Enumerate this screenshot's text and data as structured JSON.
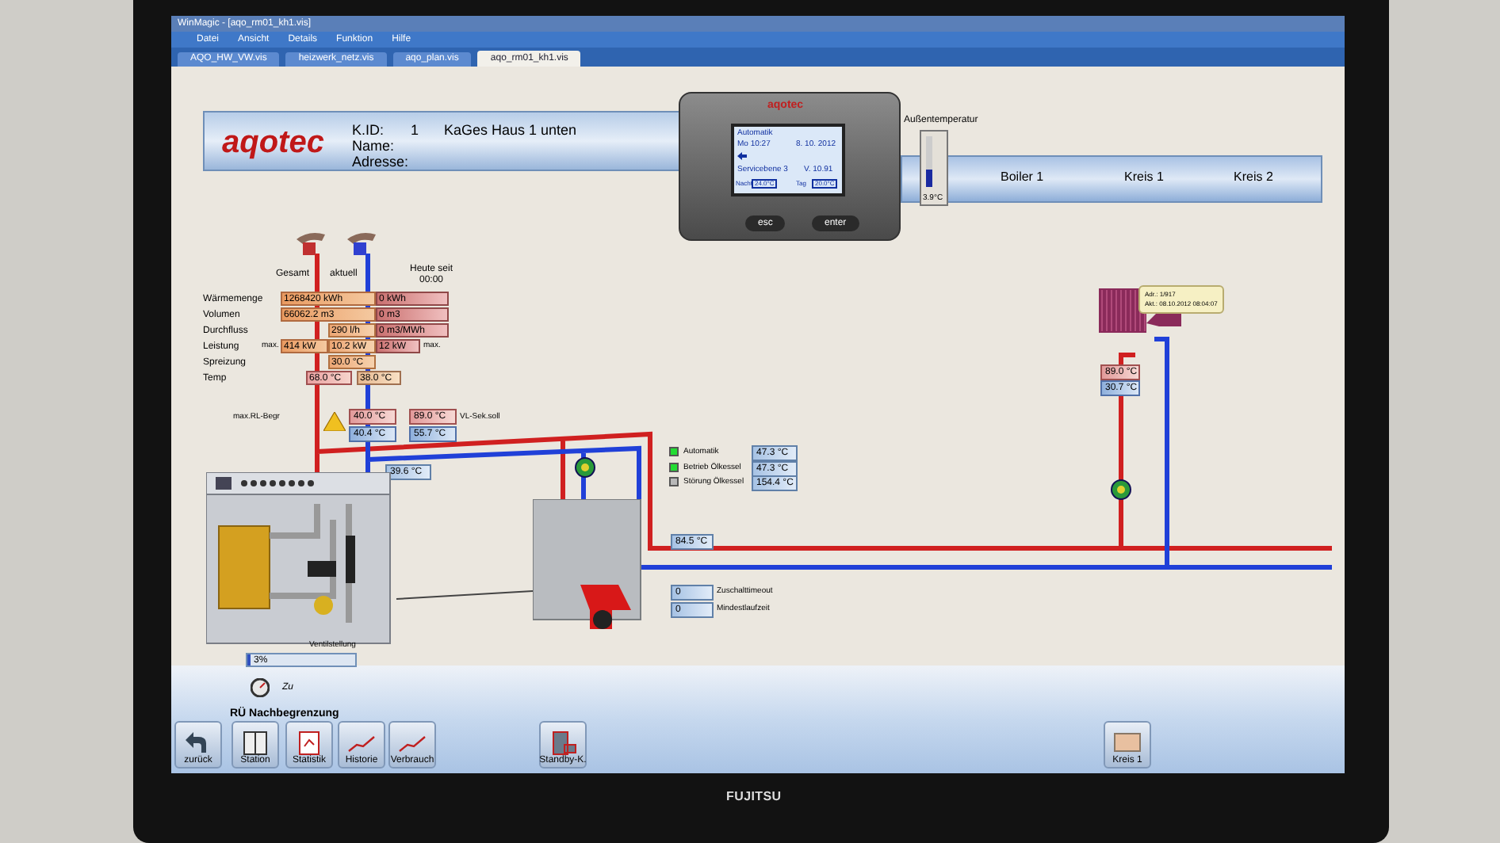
{
  "window": {
    "title": "WinMagic - [aqo_rm01_kh1.vis]"
  },
  "menu": [
    "Datei",
    "Ansicht",
    "Details",
    "Funktion",
    "Hilfe"
  ],
  "tabs": [
    {
      "label": "AQO_HW_VW.vis",
      "selected": false
    },
    {
      "label": "heizwerk_netz.vis",
      "selected": false
    },
    {
      "label": "aqo_plan.vis",
      "selected": false
    },
    {
      "label": "aqo_rm01_kh1.vis",
      "selected": true
    }
  ],
  "header": {
    "logo": "aqotec",
    "id_label": "K.ID:",
    "id": "1",
    "site": "KaGes Haus 1 unten",
    "name_label": "Name:",
    "address_label": "Adresse:"
  },
  "controller": {
    "brand": "aqotec",
    "mode": "Automatik",
    "time": "Mo 10:27",
    "date": "8. 10. 2012",
    "level_text": "Servicebene 3",
    "version": "V. 10.91",
    "night_label": "Nacht",
    "night_value": "24.0°C",
    "day_label": "Tag",
    "day_value": "20.0°C",
    "buttons": [
      "esc",
      "enter"
    ]
  },
  "outdoor": {
    "label": "Außentemperatur",
    "reading": "3.9°C",
    "level": 0.35
  },
  "circuits": [
    "Boiler 1",
    "Kreis 1",
    "Kreis 2"
  ],
  "meter": {
    "columns": [
      "Gesamt",
      "aktuell",
      "Heute seit 00:00"
    ],
    "rows": [
      {
        "label": "Wärmemenge",
        "cells": [
          {
            "text": "1268420 kWh",
            "kind": "total"
          },
          null,
          {
            "text": "0 kWh",
            "kind": "today"
          }
        ]
      },
      {
        "label": "Volumen",
        "cells": [
          {
            "text": "66062.2 m3",
            "kind": "total"
          },
          null,
          {
            "text": "0 m3",
            "kind": "today"
          }
        ]
      },
      {
        "label": "Durchfluss",
        "cells": [
          null,
          {
            "text": "290 l/h",
            "kind": "current"
          },
          {
            "text": "0 m3/MWh",
            "kind": "today"
          }
        ]
      },
      {
        "label": "Leistung",
        "max_left": "max.",
        "max_right": "max.",
        "cells": [
          {
            "text": "414 kW",
            "kind": "total"
          },
          {
            "text": "10.2 kW",
            "kind": "current"
          },
          {
            "text": "12 kW",
            "kind": "today"
          }
        ]
      },
      {
        "label": "Spreizung",
        "cells": [
          null,
          {
            "text": "30.0 °C",
            "kind": "current"
          },
          null
        ]
      },
      {
        "label": "Temp",
        "cells": [
          {
            "text": "68.0 °C",
            "kind": "supply"
          },
          {
            "text": "38.0 °C",
            "kind": "return"
          },
          null
        ]
      }
    ]
  },
  "readings": [
    {
      "text": "40.0 °C",
      "kind": "supply"
    },
    {
      "text": "40.4 °C",
      "kind": "return"
    },
    {
      "text": "89.0 °C",
      "kind": "supply"
    },
    {
      "text": "55.7 °C",
      "kind": "return"
    },
    {
      "text": "39.6 °C",
      "kind": "neutral"
    },
    {
      "text": "84.5 °C",
      "kind": "neutral"
    },
    {
      "text": "0",
      "kind": "neutral"
    },
    {
      "text": "0",
      "kind": "neutral"
    },
    {
      "text": "89.0 °C",
      "kind": "supply"
    },
    {
      "text": "30.7 °C",
      "kind": "return"
    }
  ],
  "labels": [
    "max.RL-Begr",
    "VL-Sek.soll",
    "Zuschalttimeout",
    "Mindestlaufzeit"
  ],
  "status": [
    {
      "label": "Automatik",
      "on": true,
      "value": "47.3 °C"
    },
    {
      "label": "Betrieb Ölkessel",
      "on": true,
      "value": "47.3 °C"
    },
    {
      "label": "Störung Ölkessel",
      "on": false,
      "value": "154.4 °C"
    }
  ],
  "tooltip": [
    "Adr.: 1/917",
    "Akt.: 08.10.2012 08:04:07"
  ],
  "valve": {
    "label": "Ventilstellung",
    "reading": "3%",
    "level": 0.03,
    "state": "Zu",
    "caption": "RÜ Nachbegrenzung"
  },
  "toolbar": [
    {
      "label": "zurück",
      "kind": "back"
    },
    {
      "label": "Station",
      "kind": "station"
    },
    {
      "label": "Statistik",
      "kind": "stats"
    },
    {
      "label": "Historie",
      "kind": "history"
    },
    {
      "label": "Verbrauch",
      "kind": "consumption"
    },
    {
      "label": "Standby-K.",
      "kind": "standby"
    },
    {
      "label": "Kreis 1",
      "kind": "circuit"
    }
  ],
  "monitor": {
    "brand": "FUJITSU"
  }
}
